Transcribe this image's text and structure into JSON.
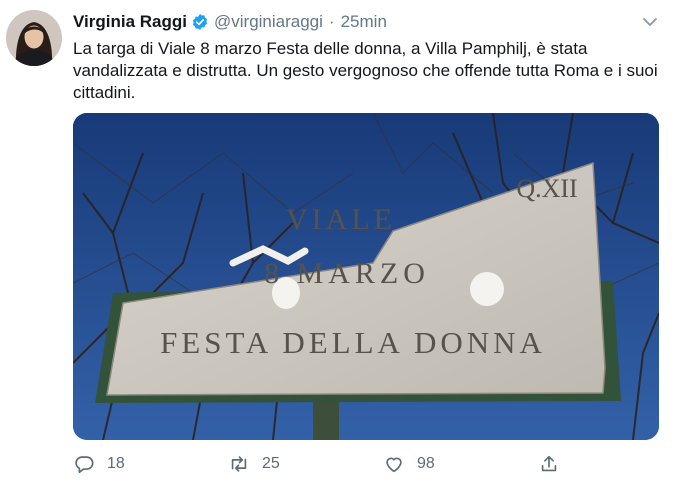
{
  "tweet": {
    "author_name": "Virginia Raggi",
    "handle": "@virginiaraggi",
    "separator": "·",
    "time": "25min",
    "text": "La targa di Viale 8 marzo Festa delle donna, a Villa Pamphilj, è stata vandalizzata e distrutta. Un gesto vergognoso che offende tutta Roma e i suoi cittadini."
  },
  "media": {
    "plaque_line1": "Q.XII",
    "plaque_line2": "VIALE",
    "plaque_line3": "8 MARZO",
    "plaque_line4": "FESTA DELLA DONNA"
  },
  "actions": {
    "reply_count": "18",
    "retweet_count": "25",
    "like_count": "98"
  },
  "icons": {
    "verified": "verified-badge-icon",
    "menu": "chevron-down-icon",
    "reply": "reply-icon",
    "retweet": "retweet-icon",
    "like": "heart-icon",
    "share": "share-icon"
  },
  "colors": {
    "verified": "#1da1f2",
    "secondary_text": "#657786",
    "sky": "#1d3f7c"
  }
}
